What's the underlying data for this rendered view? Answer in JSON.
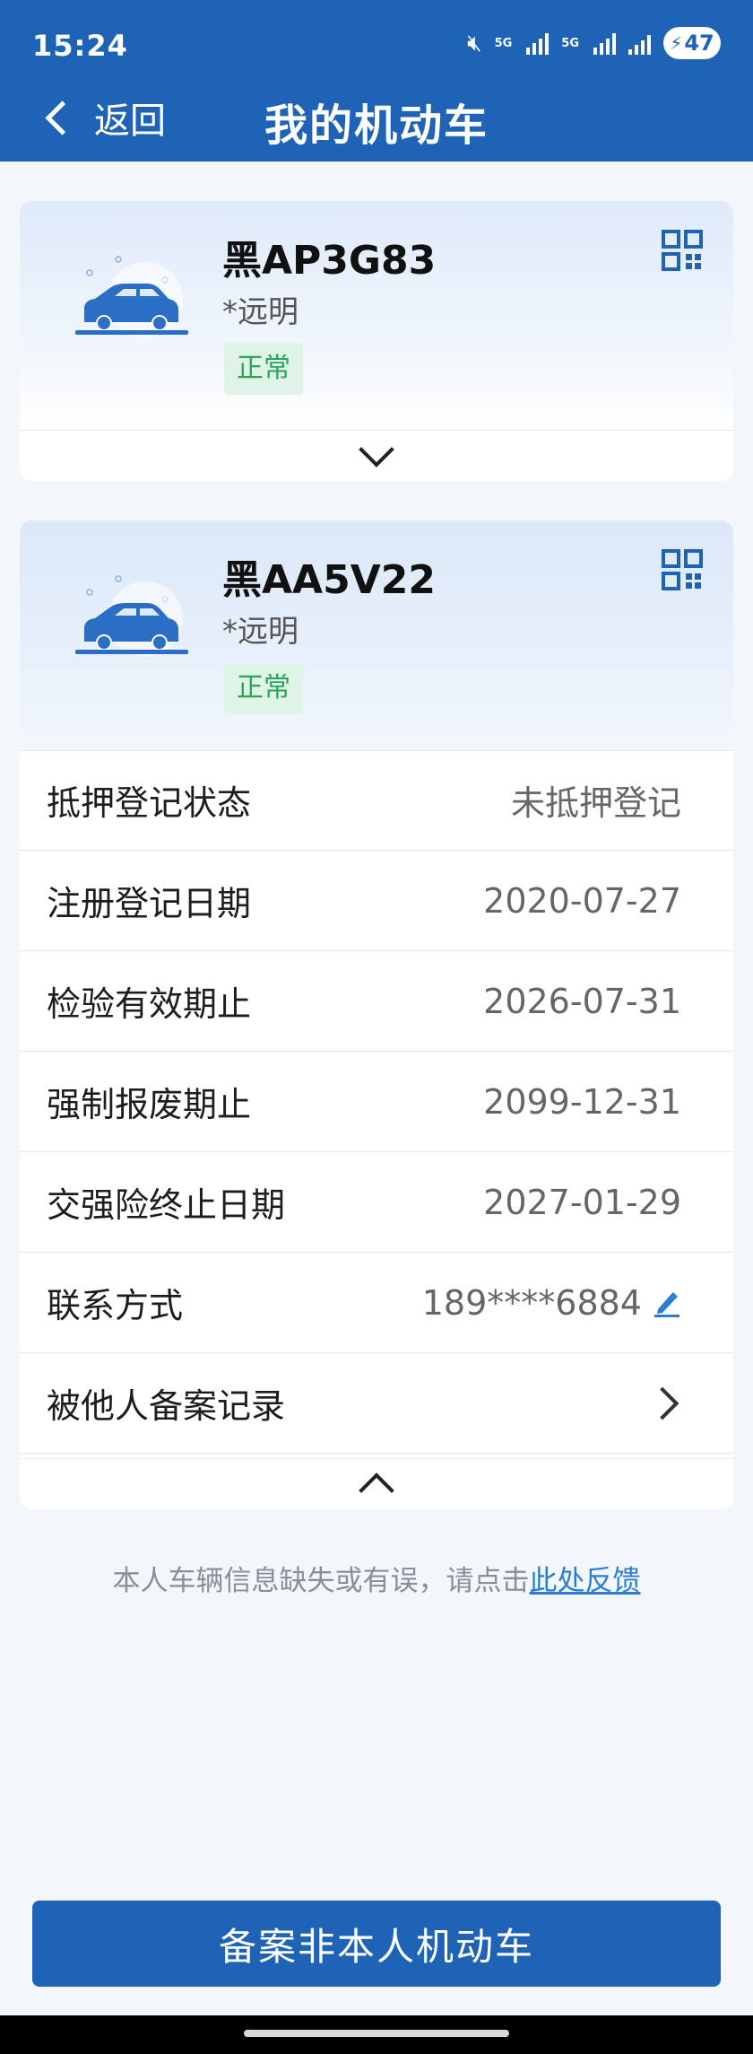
{
  "status_bar": {
    "time": "15:24",
    "signal1_label": "5G",
    "signal2_label": "5G",
    "battery": "47",
    "icons": [
      "mute-icon",
      "signal-icon",
      "signal-icon",
      "signal-icon",
      "battery-charging-icon"
    ]
  },
  "header": {
    "back_label": "返回",
    "title": "我的机动车"
  },
  "vehicles": [
    {
      "plate": "黑AP3G83",
      "owner": "*远明",
      "status": "正常",
      "expanded": false
    },
    {
      "plate": "黑AA5V22",
      "owner": "*远明",
      "status": "正常",
      "expanded": true,
      "details": [
        {
          "label": "抵押登记状态",
          "value": "未抵押登记"
        },
        {
          "label": "注册登记日期",
          "value": "2020-07-27"
        },
        {
          "label": "检验有效期止",
          "value": "2026-07-31"
        },
        {
          "label": "强制报废期止",
          "value": "2099-12-31"
        },
        {
          "label": "交强险终止日期",
          "value": "2027-01-29"
        },
        {
          "label": "联系方式",
          "value": "189****6884"
        },
        {
          "label": "被他人备案记录",
          "value": ""
        }
      ]
    }
  ],
  "feedback": {
    "text": "本人车辆信息缺失或有误，请点击",
    "link": "此处反馈"
  },
  "primary_button": "备案非本人机动车",
  "colors": {
    "brand_blue": "#1f63b6",
    "status_green": "#2da45a",
    "link_blue": "#2a7dd1"
  }
}
